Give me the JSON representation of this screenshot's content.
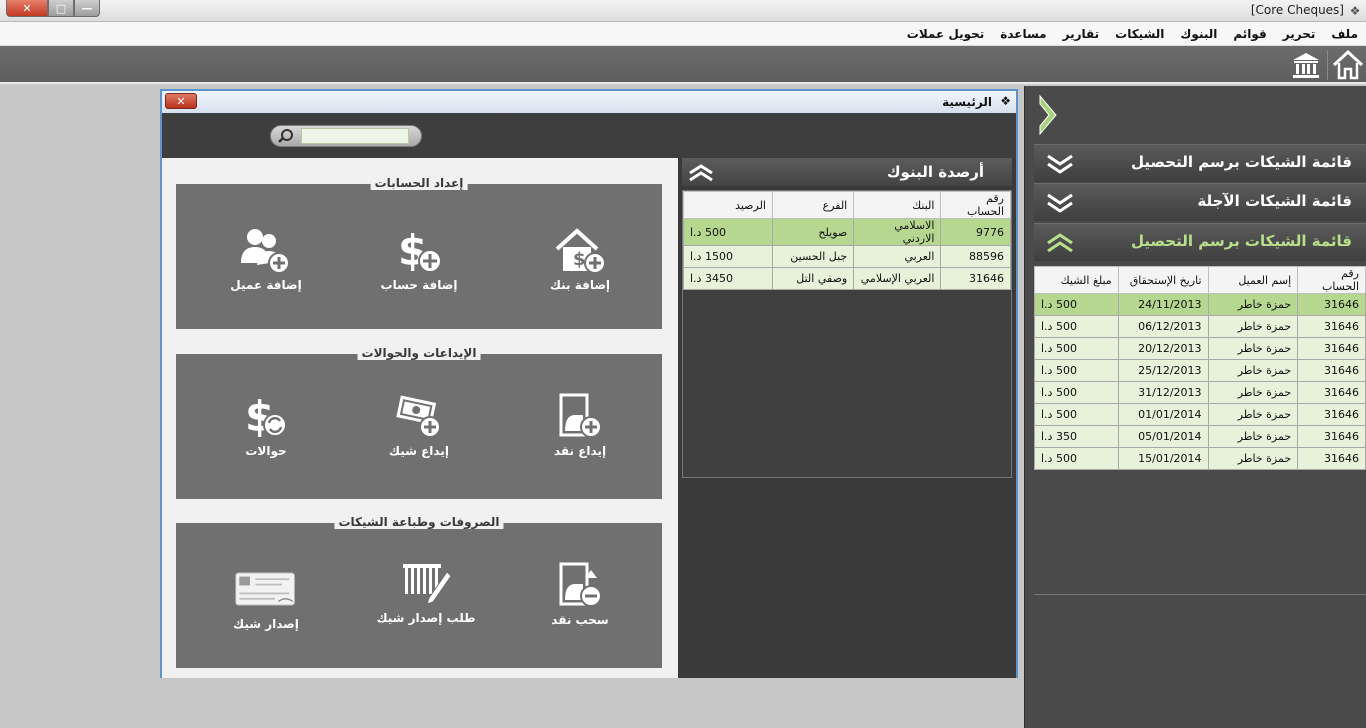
{
  "window": {
    "title": "[Core Cheques]",
    "close_label": "✕",
    "max_label": "□",
    "min_label": "—"
  },
  "menu": [
    "ملف",
    "تحرير",
    "قوائم",
    "البنوك",
    "الشيكات",
    "تقارير",
    "مساعدة",
    "تحويل عملات"
  ],
  "toolbar": {
    "home_icon": "home-icon",
    "bank_icon": "bank-icon"
  },
  "side_panel": {
    "sections": [
      {
        "label": "قائمة الشيكات برسم التحصيل",
        "state": "collapsed"
      },
      {
        "label": "قائمة الشيكات الآجلة",
        "state": "collapsed"
      },
      {
        "label": "قائمة الشيكات برسم التحصيل",
        "state": "expanded"
      }
    ],
    "table": {
      "headers": [
        "رقم الحساب",
        "إسم العميل",
        "تاريخ الإستحقاق",
        "مبلغ الشيك"
      ],
      "rows": [
        [
          "31646",
          "حمزة خاطر",
          "24/11/2013",
          "500 د.ا"
        ],
        [
          "31646",
          "حمزة خاطر",
          "06/12/2013",
          "500 د.ا"
        ],
        [
          "31646",
          "حمزة خاطر",
          "20/12/2013",
          "500 د.ا"
        ],
        [
          "31646",
          "حمزة خاطر",
          "25/12/2013",
          "500 د.ا"
        ],
        [
          "31646",
          "حمزة خاطر",
          "31/12/2013",
          "500 د.ا"
        ],
        [
          "31646",
          "حمزة خاطر",
          "01/01/2014",
          "500 د.ا"
        ],
        [
          "31646",
          "حمزة خاطر",
          "05/01/2014",
          "350 د.ا"
        ],
        [
          "31646",
          "حمزة خاطر",
          "15/01/2014",
          "500 د.ا"
        ]
      ]
    }
  },
  "inner_window": {
    "title": "الرئيسية",
    "close_label": "✕",
    "search": {
      "value": "",
      "placeholder": ""
    },
    "groups": [
      {
        "title": "إعداد الحسابات",
        "items": [
          {
            "label": "إضافة بنك",
            "icon": "add-bank-icon"
          },
          {
            "label": "إضافة حساب",
            "icon": "add-account-icon"
          },
          {
            "label": "إضافة عميل",
            "icon": "add-customer-icon"
          }
        ]
      },
      {
        "title": "الإيداعات والحوالات",
        "items": [
          {
            "label": "إيداع نقد",
            "icon": "cash-deposit-icon"
          },
          {
            "label": "إيداع شيك",
            "icon": "cheque-deposit-icon"
          },
          {
            "label": "حوالات",
            "icon": "transfers-icon"
          }
        ]
      },
      {
        "title": "الصروفات وطباعة الشيكات",
        "items": [
          {
            "label": "سحب نقد",
            "icon": "cash-withdraw-icon"
          },
          {
            "label": "طلب إصدار شيك",
            "icon": "cheque-request-icon"
          },
          {
            "label": "إصدار شيك",
            "icon": "issue-cheque-icon"
          }
        ]
      }
    ],
    "bank_balances": {
      "title": "أرصدة البنوك",
      "headers": [
        "رقم الحساب",
        "البنك",
        "الفرع",
        "الرصيد"
      ],
      "rows": [
        [
          "9776",
          "الاسلامي الاردني",
          "صويلح",
          "500 د.ا"
        ],
        [
          "88596",
          "العربي",
          "جبل الحسين",
          "1500 د.ا"
        ],
        [
          "31646",
          "العربي الإسلامي",
          "وصفي التل",
          "3450 د.ا"
        ]
      ]
    }
  },
  "colors": {
    "accent_green": "#b8e08a",
    "row_selected": "#b6d790",
    "row": "#e8f1d9",
    "panel_dark": "#4a4a4a",
    "window_border": "#5e95c8"
  }
}
